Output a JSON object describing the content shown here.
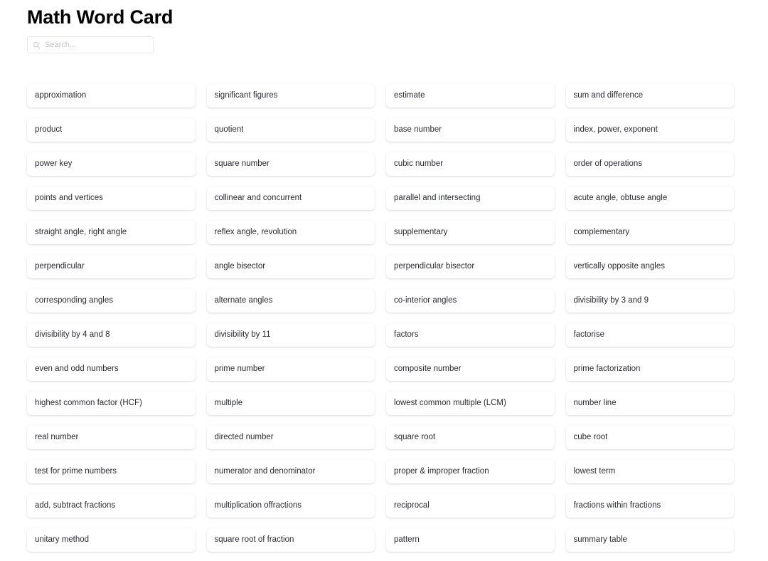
{
  "header": {
    "title": "Math Word Card"
  },
  "search": {
    "icon": "search-icon",
    "placeholder": "Search...",
    "value": ""
  },
  "colors": {
    "page_background": "#ffffff",
    "card_background": "#ffffff",
    "text": "#2b2b35",
    "title": "#000000",
    "placeholder": "#c2c2cf",
    "border": "#e6e6ef"
  },
  "grid": {
    "columns": 4,
    "count": 56,
    "cards": [
      {
        "label": "approximation"
      },
      {
        "label": "significant figures"
      },
      {
        "label": "estimate"
      },
      {
        "label": "sum and difference"
      },
      {
        "label": "product"
      },
      {
        "label": "quotient"
      },
      {
        "label": "base number"
      },
      {
        "label": "index, power, exponent"
      },
      {
        "label": "power key"
      },
      {
        "label": "square number"
      },
      {
        "label": "cubic number"
      },
      {
        "label": "order of operations"
      },
      {
        "label": "points and vertices"
      },
      {
        "label": "collinear and concurrent"
      },
      {
        "label": "parallel and intersecting"
      },
      {
        "label": "acute angle, obtuse angle"
      },
      {
        "label": "straight angle, right angle"
      },
      {
        "label": "reflex angle, revolution"
      },
      {
        "label": "supplementary"
      },
      {
        "label": "complementary"
      },
      {
        "label": "perpendicular"
      },
      {
        "label": "angle bisector"
      },
      {
        "label": "perpendicular bisector"
      },
      {
        "label": "vertically opposite angles"
      },
      {
        "label": "corresponding angles"
      },
      {
        "label": "alternate angles"
      },
      {
        "label": "co-interior angles"
      },
      {
        "label": "divisibility by 3 and 9"
      },
      {
        "label": "divisibility by 4 and 8"
      },
      {
        "label": "divisibility by 11"
      },
      {
        "label": "factors"
      },
      {
        "label": "factorise"
      },
      {
        "label": "even and odd numbers"
      },
      {
        "label": "prime number"
      },
      {
        "label": "composite number"
      },
      {
        "label": "prime factorization"
      },
      {
        "label": "highest common factor (HCF)"
      },
      {
        "label": "multiple"
      },
      {
        "label": "lowest common multiple (LCM)"
      },
      {
        "label": "number line"
      },
      {
        "label": "real number"
      },
      {
        "label": "directed number"
      },
      {
        "label": "square root"
      },
      {
        "label": "cube root"
      },
      {
        "label": "test for prime numbers"
      },
      {
        "label": "numerator and denominator"
      },
      {
        "label": "proper & improper fraction"
      },
      {
        "label": "lowest term"
      },
      {
        "label": "add, subtract fractions"
      },
      {
        "label": "multiplication offractions"
      },
      {
        "label": "reciprocal"
      },
      {
        "label": "fractions within fractions"
      },
      {
        "label": "unitary method"
      },
      {
        "label": "square root of fraction"
      },
      {
        "label": "pattern"
      },
      {
        "label": "summary table"
      }
    ]
  }
}
